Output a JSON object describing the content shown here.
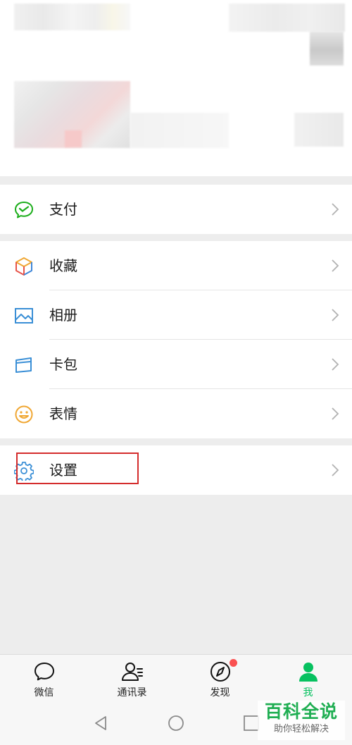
{
  "menu": {
    "pay": {
      "label": "支付",
      "icon": "wechat-pay-icon"
    },
    "favorites": {
      "label": "收藏",
      "icon": "favorites-cube-icon"
    },
    "album": {
      "label": "相册",
      "icon": "album-picture-icon"
    },
    "cards": {
      "label": "卡包",
      "icon": "card-wallet-icon"
    },
    "stickers": {
      "label": "表情",
      "icon": "smiley-icon"
    },
    "settings": {
      "label": "设置",
      "icon": "gear-icon"
    }
  },
  "tabbar": {
    "tabs": [
      {
        "label": "微信",
        "icon": "chat-bubble-icon",
        "active": false
      },
      {
        "label": "通讯录",
        "icon": "contacts-icon",
        "active": false
      },
      {
        "label": "发现",
        "icon": "compass-icon",
        "active": false,
        "badge": true
      },
      {
        "label": "我",
        "icon": "person-icon",
        "active": true
      }
    ]
  },
  "watermark": {
    "title": "百科全说",
    "subtitle": "助你轻松解决"
  },
  "colors": {
    "accent_green": "#07c160",
    "badge_red": "#fa5151",
    "highlight_red": "#d42c2c"
  }
}
